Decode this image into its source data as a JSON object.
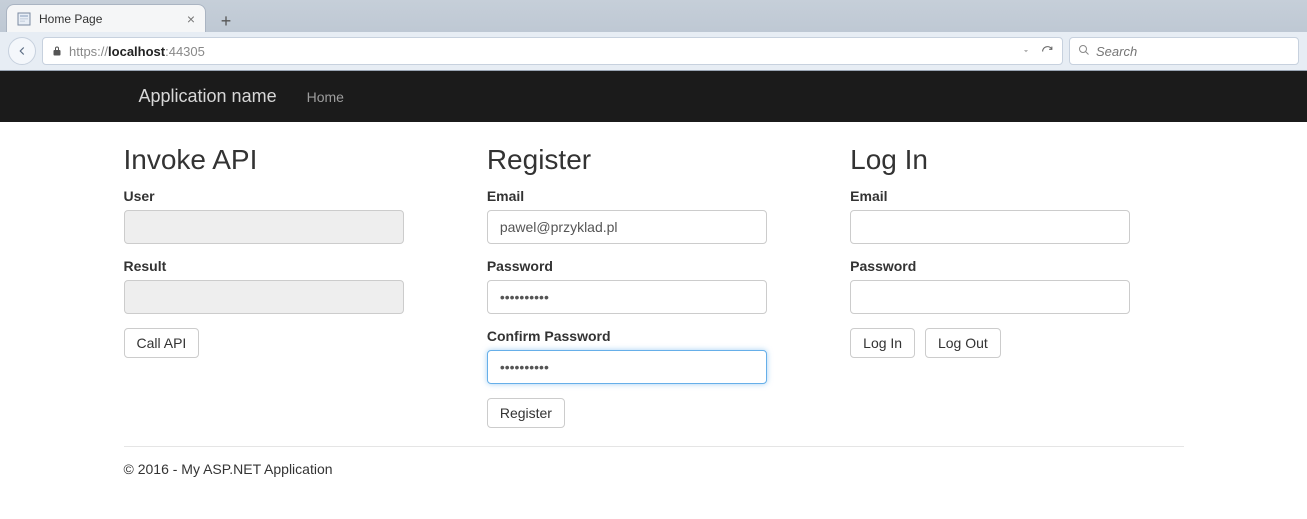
{
  "browser": {
    "tab_title": "Home Page",
    "url_proto": "https://",
    "url_host": "localhost",
    "url_port": ":44305",
    "search_placeholder": "Search"
  },
  "navbar": {
    "brand": "Application name",
    "links": {
      "home": "Home"
    }
  },
  "invoke": {
    "heading": "Invoke API",
    "labels": {
      "user": "User",
      "result": "Result"
    },
    "values": {
      "user": "",
      "result": ""
    },
    "buttons": {
      "call": "Call API"
    }
  },
  "register": {
    "heading": "Register",
    "labels": {
      "email": "Email",
      "password": "Password",
      "confirm": "Confirm Password"
    },
    "values": {
      "email": "pawel@przyklad.pl",
      "password": "••••••••••",
      "confirm": "••••••••••"
    },
    "buttons": {
      "submit": "Register"
    }
  },
  "login": {
    "heading": "Log In",
    "labels": {
      "email": "Email",
      "password": "Password"
    },
    "values": {
      "email": "",
      "password": ""
    },
    "buttons": {
      "login": "Log In",
      "logout": "Log Out"
    }
  },
  "footer": {
    "text": "© 2016 - My ASP.NET Application"
  }
}
